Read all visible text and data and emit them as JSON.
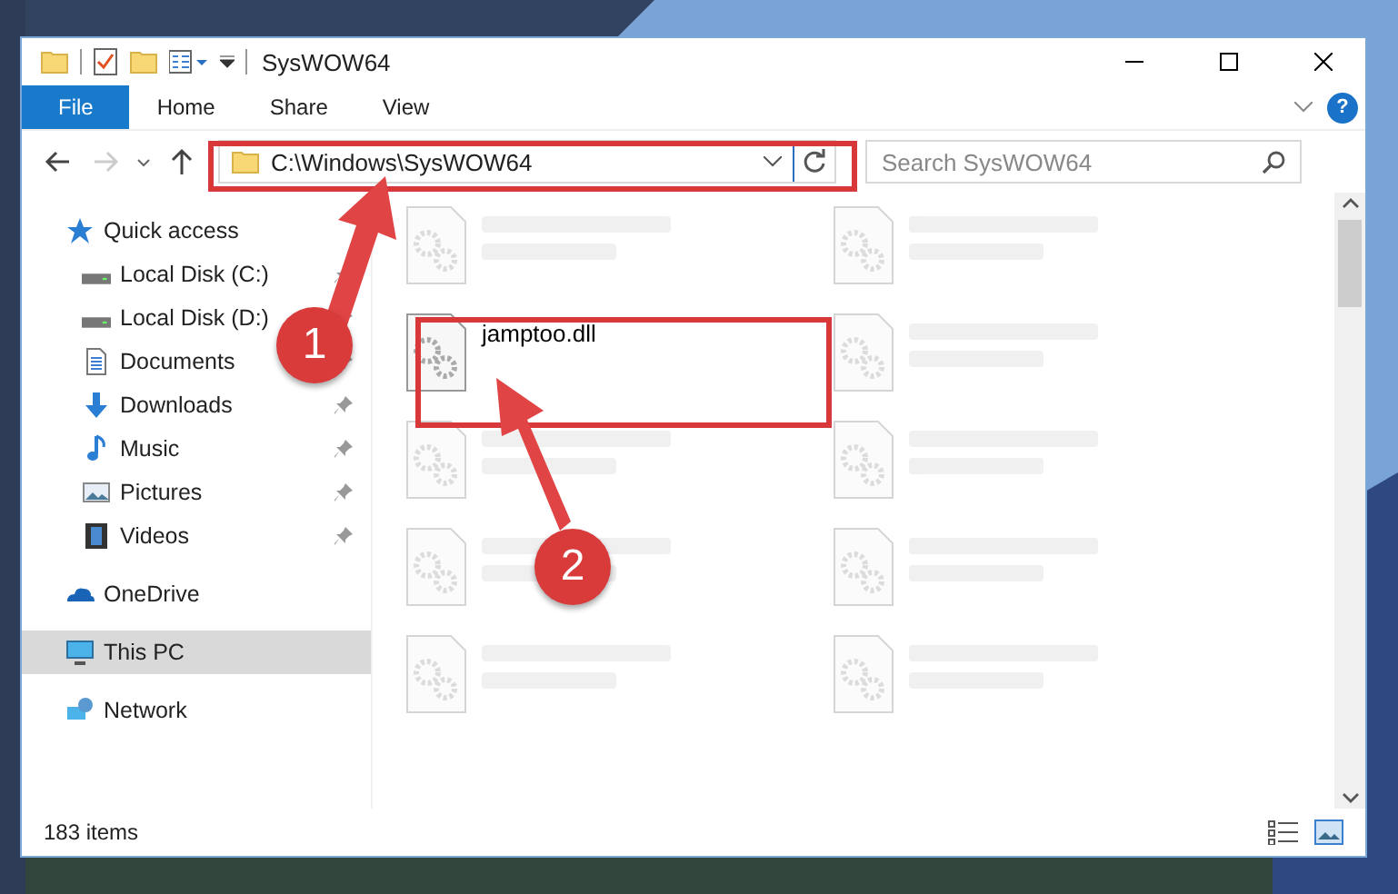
{
  "window": {
    "title": "SysWOW64"
  },
  "ribbon": {
    "tabs": [
      {
        "label": "File",
        "selected": true
      },
      {
        "label": "Home",
        "selected": false
      },
      {
        "label": "Share",
        "selected": false
      },
      {
        "label": "View",
        "selected": false
      }
    ],
    "help": "?"
  },
  "address_bar": {
    "path": "C:\\Windows\\SysWOW64"
  },
  "search": {
    "placeholder": "Search SysWOW64"
  },
  "navigation": [
    {
      "label": "Quick access",
      "kind": "quick",
      "selected": false,
      "children": [
        {
          "label": "Local Disk (C:)",
          "kind": "disk",
          "pinned": true
        },
        {
          "label": "Local Disk (D:)",
          "kind": "disk",
          "pinned": true
        },
        {
          "label": "Documents",
          "kind": "documents",
          "pinned": true
        },
        {
          "label": "Downloads",
          "kind": "downloads",
          "pinned": true
        },
        {
          "label": "Music",
          "kind": "music",
          "pinned": true
        },
        {
          "label": "Pictures",
          "kind": "pictures",
          "pinned": true
        },
        {
          "label": "Videos",
          "kind": "videos",
          "pinned": true
        }
      ]
    },
    {
      "label": "OneDrive",
      "kind": "onedrive",
      "selected": false
    },
    {
      "label": "This PC",
      "kind": "pc",
      "selected": true
    },
    {
      "label": "Network",
      "kind": "network",
      "selected": false
    }
  ],
  "files": [
    {
      "blurred": true
    },
    {
      "blurred": true
    },
    {
      "name": "jamptoo.dll",
      "blurred": false
    },
    {
      "blurred": true
    },
    {
      "blurred": true
    },
    {
      "blurred": true
    },
    {
      "blurred": true
    },
    {
      "blurred": true
    },
    {
      "blurred": true
    },
    {
      "blurred": true
    }
  ],
  "status_bar": {
    "item_count": "183 items"
  },
  "annotations": [
    {
      "number": "1"
    },
    {
      "number": "2"
    }
  ]
}
